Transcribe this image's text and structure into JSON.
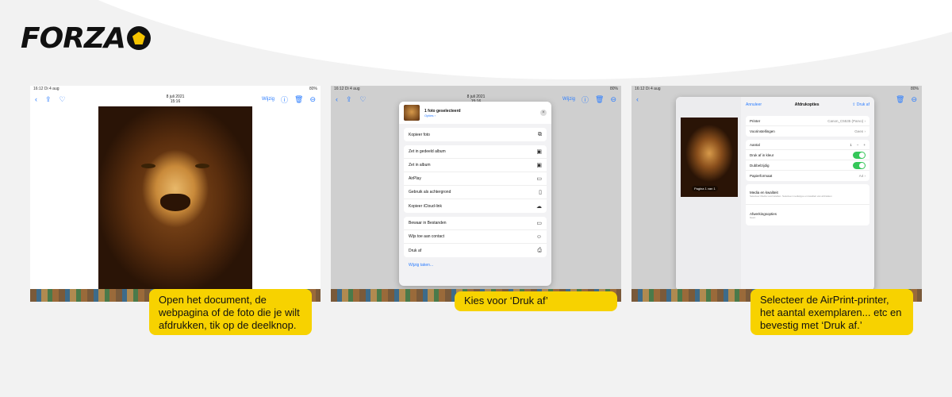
{
  "brand": {
    "logo_text": "FORZA",
    "accent": "#f7d200"
  },
  "screens": {
    "s1": {
      "status_left": "16:12  Di 4 aug",
      "status_right": "80%",
      "back_icon": "chevron-left-icon",
      "nav_date": "8 juli 2021",
      "nav_time": "15:16",
      "edit_label": "Wijzig"
    },
    "s2": {
      "status_left": "16:12  Di 4 aug",
      "status_right": "80%",
      "nav_date": "8 juli 2021",
      "nav_time": "15:16",
      "edit_label": "Wijzig",
      "sheet_title": "1 foto geselecteerd",
      "sheet_options": "Opties ›",
      "rows_group1": [
        "Kopieer foto"
      ],
      "rows_group2": [
        "Zet in gedeeld album",
        "Zet in album",
        "AirPlay",
        "Gebruik als achtergrond",
        "Kopieer iCloud-link"
      ],
      "rows_group3": [
        "Bewaar in Bestanden",
        "Wijs toe aan contact",
        "Druk af"
      ],
      "edit_actions": "Wijzig taken..."
    },
    "s3": {
      "status_left": "16:12  Di 4 aug",
      "status_right": "80%",
      "cancel_label": "Annuleer",
      "panel_title": "Afdrukopties",
      "print_label": "Druk af",
      "thumb_label": "Pagina 1 van 1",
      "printer_label": "Printer",
      "printer_value": "Canon_C5535 (Parvo) ›",
      "presets_label": "Voorinstellingen",
      "presets_value": "Geen ›",
      "copies_label": "Aantal",
      "copies_value": "1",
      "color_label": "Druk af in kleur",
      "duplex_label": "Dubbelzijdig",
      "paper_label": "Papierformaat",
      "paper_value": "A4 ›",
      "media_label": "Media en kwaliteit",
      "media_sub": "Selecteer Media voorinstellen. Selecteer mediatype en kwaliteit van afdrukken",
      "layout_label": "Afwerkingsopties",
      "layout_sub": "Geen"
    }
  },
  "callouts": {
    "c1": "Open het document, de webpagina of de foto die je wilt afdrukken, tik op de deelknop.",
    "c2": "Kies voor ‘Druk af’",
    "c3": "Selecteer de AirPrint-printer, het aantal exemplaren... etc en bevestig met ‘Druk af.’"
  }
}
